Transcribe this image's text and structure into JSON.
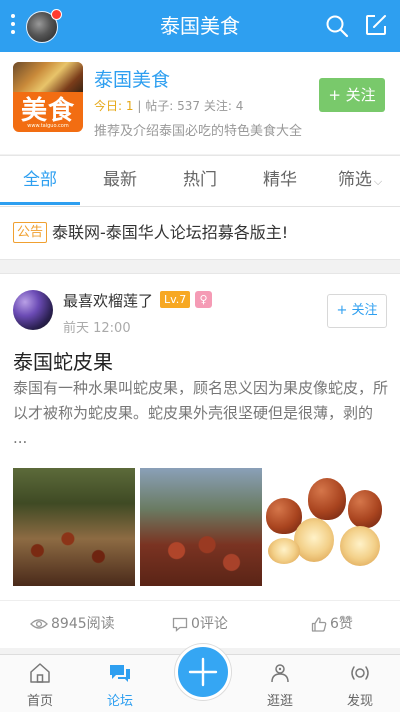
{
  "header": {
    "title": "泰国美食"
  },
  "forum": {
    "logo_word": "美食",
    "logo_url": "www.taiguo.com",
    "name": "泰国美食",
    "today_label": "今日",
    "today_value": "1",
    "posts_label": "帖子",
    "posts_value": "537",
    "follows_label": "关注",
    "follows_value": "4",
    "description": "推荐及介绍泰国必吃的特色美食大全",
    "follow_button": "+ 关注"
  },
  "tabs": [
    {
      "label": "全部",
      "active": true
    },
    {
      "label": "最新"
    },
    {
      "label": "热门"
    },
    {
      "label": "精华"
    },
    {
      "label": "筛选"
    }
  ],
  "notice": {
    "tag": "公告",
    "text": "泰联网-泰国华人论坛招募各版主!"
  },
  "post": {
    "author": "最喜欢榴莲了",
    "level": "Lv.7",
    "time": "前天 12:00",
    "follow_button": "+ 关注",
    "title": "泰国蛇皮果",
    "body": "泰国有一种水果叫蛇皮果，顾名思义因为果皮像蛇皮，所以才被称为蛇皮果。蛇皮果外壳很坚硬但是很薄，剥的 ...",
    "reads": "8945阅读",
    "comments": "0评论",
    "likes": "6赞"
  },
  "bottom_nav": [
    {
      "label": "首页",
      "icon": "home-icon"
    },
    {
      "label": "论坛",
      "icon": "forum-icon",
      "active": true
    },
    {
      "label": "",
      "icon": "plus-icon"
    },
    {
      "label": "逛逛",
      "icon": "stroll-icon"
    },
    {
      "label": "发现",
      "icon": "discover-icon"
    }
  ],
  "colors": {
    "primary": "#2e9ff0",
    "follow_green": "#79c96b",
    "level_orange": "#f7a823",
    "notice_orange": "#f0a030"
  }
}
